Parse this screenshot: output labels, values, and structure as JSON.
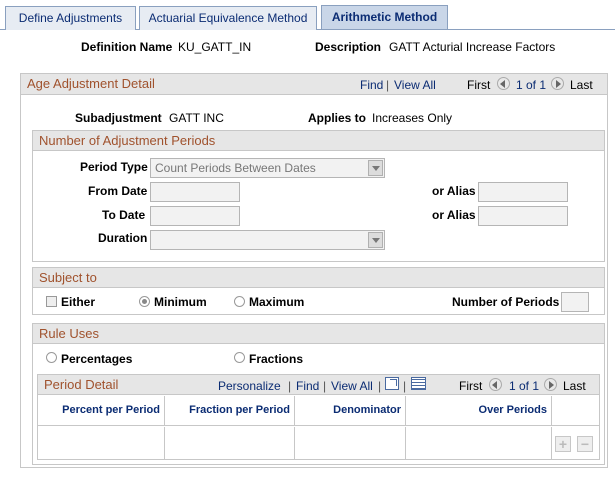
{
  "tabs": [
    {
      "label": "Define Adjustments"
    },
    {
      "label": "Actuarial Equivalence Method"
    },
    {
      "label": "Arithmetic Method"
    }
  ],
  "header": {
    "definition_name_label": "Definition Name",
    "definition_name_value": "KU_GATT_IN",
    "description_label": "Description",
    "description_value": "GATT Acturial Increase Factors"
  },
  "age_adjustment": {
    "title": "Age Adjustment Detail",
    "find": "Find",
    "sep": "|",
    "view_all": "View All",
    "first": "First",
    "count": "1 of 1",
    "last": "Last",
    "subadjustment_label": "Subadjustment",
    "subadjustment_value": "GATT INC",
    "applies_to_label": "Applies to",
    "applies_to_value": "Increases Only"
  },
  "periods": {
    "title": "Number of Adjustment Periods",
    "period_type_label": "Period Type",
    "period_type_value": "Count Periods Between Dates",
    "from_date_label": "From Date",
    "to_date_label": "To Date",
    "or_alias_label": "or Alias",
    "duration_label": "Duration",
    "duration_value": ""
  },
  "subject_to": {
    "title": "Subject to",
    "either": "Either",
    "minimum": "Minimum",
    "maximum": "Maximum",
    "selected": "minimum",
    "number_of_periods_label": "Number of Periods"
  },
  "rule_uses": {
    "title": "Rule Uses",
    "percentages": "Percentages",
    "fractions": "Fractions"
  },
  "period_detail": {
    "title": "Period Detail",
    "personalize": "Personalize",
    "find": "Find",
    "sep": "|",
    "view_all": "View All",
    "first": "First",
    "count": "1 of 1",
    "last": "Last",
    "columns": [
      "Percent per Period",
      "Fraction per Period",
      "Denominator",
      "Over Periods"
    ],
    "add": "+",
    "remove": "−"
  },
  "colors": {
    "section_title": "#a0522d",
    "link": "#0b2c73",
    "header_bg": "#e6e6e6"
  }
}
